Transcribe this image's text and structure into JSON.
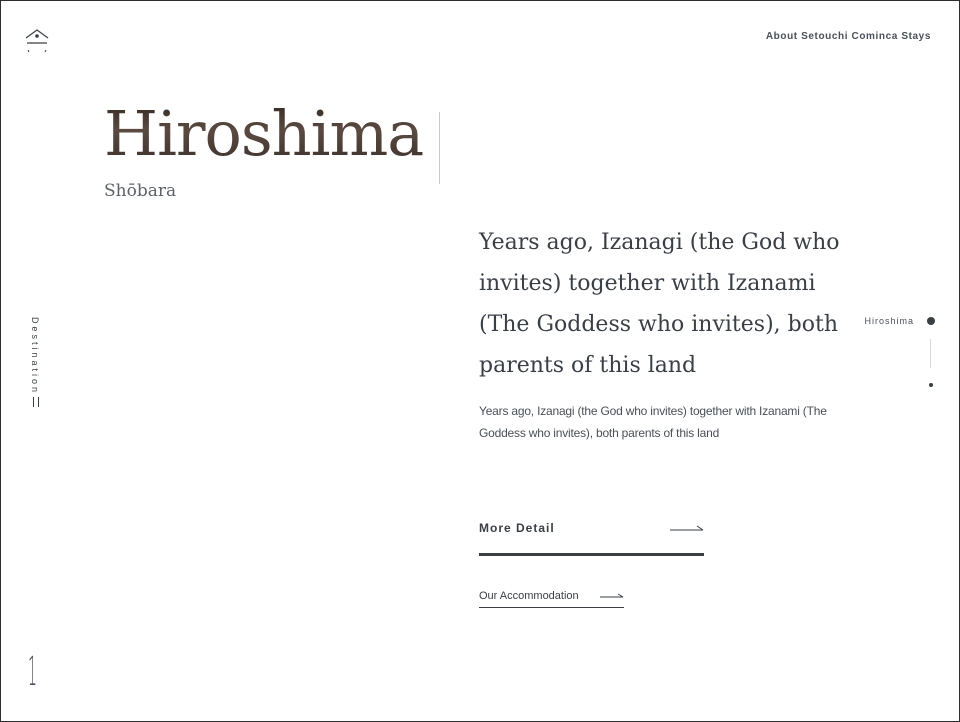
{
  "header": {
    "logo_icon": "house-roof-icon",
    "about_link": "About Setouchi Cominca Stays"
  },
  "hero": {
    "title": "Hiroshima",
    "subtitle": "Shōbara"
  },
  "content": {
    "lead": "Years ago, Izanagi (the God who invites) together with Izanami (The Goddess who invites), both parents of this land",
    "body": "Years ago, Izanagi (the God who invites) together with Izanami (The Goddess who invites), both parents of this land",
    "more_detail_label": "More Detail",
    "accommodation_label": "Our Accommodation"
  },
  "side_nav": {
    "active_label": "Hiroshima"
  },
  "left_rail": {
    "section_label": "Destination",
    "page_number": "1"
  },
  "colors": {
    "text": "#3a3f44",
    "frame": "#2e2e2e",
    "title_tone": "#4a3e38"
  }
}
